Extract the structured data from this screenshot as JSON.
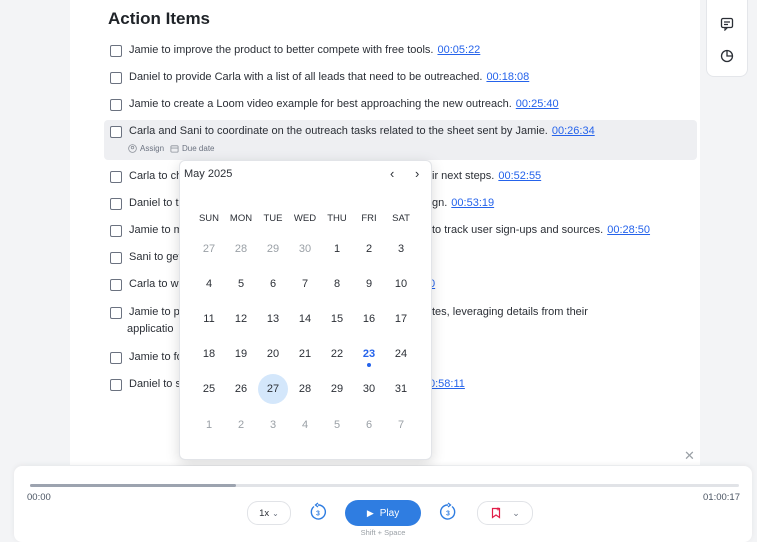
{
  "section_title": "Action Items",
  "items": [
    {
      "text": "Jamie to improve the product to better compete with free tools.",
      "ts": "00:05:22"
    },
    {
      "text": "Daniel to provide Carla with a list of all leads that need to be outreached.",
      "ts": "00:18:08"
    },
    {
      "text": "Jamie to create a Loom video example for best approaching the new outreach.",
      "ts": "00:25:40"
    },
    {
      "text": "Carla and Sani to coordinate on the outreach tasks related to the sheet sent by Jamie.",
      "ts": "00:26:34"
    },
    {
      "text": "Carla to ch",
      "tail": "ir next steps.",
      "ts": "00:52:55"
    },
    {
      "text": "Daniel to t",
      "tail": "gn.",
      "ts": "00:53:19"
    },
    {
      "text": "Jamie to m",
      "tail": "to track user sign-ups and sources.",
      "ts": "00:28:50"
    },
    {
      "text": "Sani to get"
    },
    {
      "text": "Carla to wo",
      "ts": "0"
    },
    {
      "text": "Jamie to p",
      "line2": "applicatio",
      "tail": "tes, leveraging details from their"
    },
    {
      "text": "Jamie to fo"
    },
    {
      "text": "Daniel to s",
      "ts": "0:58:11"
    }
  ],
  "chips": {
    "assign": "Assign",
    "due_date": "Due date"
  },
  "datepicker": {
    "month_label": "May 2025",
    "weekdays": [
      "SUN",
      "MON",
      "TUE",
      "WED",
      "THU",
      "FRI",
      "SAT"
    ],
    "weeks": [
      [
        "27",
        "28",
        "29",
        "30",
        "1",
        "2",
        "3"
      ],
      [
        "4",
        "5",
        "6",
        "7",
        "8",
        "9",
        "10"
      ],
      [
        "11",
        "12",
        "13",
        "14",
        "15",
        "16",
        "17"
      ],
      [
        "18",
        "19",
        "20",
        "21",
        "22",
        "23",
        "24"
      ],
      [
        "25",
        "26",
        "27",
        "28",
        "29",
        "30",
        "31"
      ],
      [
        "1",
        "2",
        "3",
        "4",
        "5",
        "6",
        "7"
      ]
    ],
    "today": "23",
    "hovered": "27"
  },
  "player": {
    "current_time": "00:00",
    "total_time": "01:00:17",
    "speed": "1x",
    "play_label": "Play",
    "play_hint": "Shift + Space",
    "progress": 0.29
  },
  "colors": {
    "accent": "#2f7de1",
    "link": "#2563eb"
  }
}
